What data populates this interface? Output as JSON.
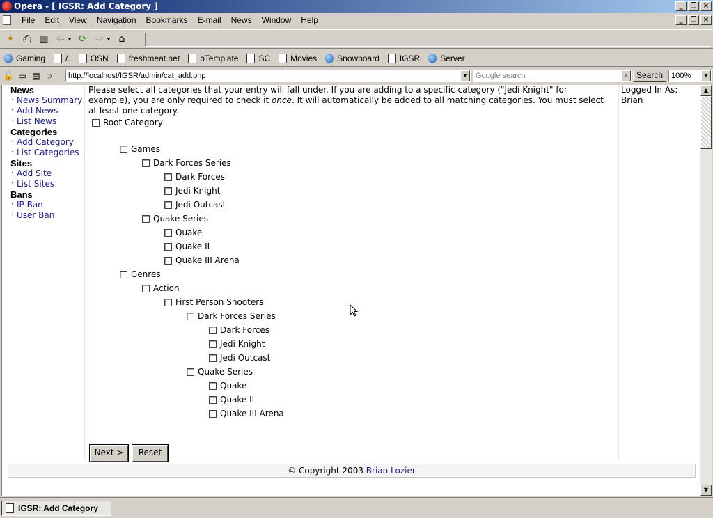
{
  "window": {
    "title": "Opera - [ IGSR: Add Category ]"
  },
  "menu": [
    "File",
    "Edit",
    "View",
    "Navigation",
    "Bookmarks",
    "E-mail",
    "News",
    "Window",
    "Help"
  ],
  "bookmarks": [
    {
      "label": "Gaming",
      "icon": "globe-icon"
    },
    {
      "label": "/.",
      "icon": "page-icon"
    },
    {
      "label": "OSN",
      "icon": "page-icon"
    },
    {
      "label": "freshmeat.net",
      "icon": "page-icon"
    },
    {
      "label": "bTemplate",
      "icon": "page-icon"
    },
    {
      "label": "SC",
      "icon": "page-icon"
    },
    {
      "label": "Movies",
      "icon": "page-icon"
    },
    {
      "label": "Snowboard",
      "icon": "globe-icon"
    },
    {
      "label": "IGSR",
      "icon": "page-icon"
    },
    {
      "label": "Server",
      "icon": "globe-icon"
    }
  ],
  "address": {
    "url": "http://localhost/IGSR/admin/cat_add.php",
    "search_placeholder": "Google search",
    "search_button": "Search",
    "zoom": "100%"
  },
  "nav": {
    "sections": [
      {
        "heading": "News",
        "links": [
          "News Summary",
          "Add News",
          "List News"
        ]
      },
      {
        "heading": "Categories",
        "links": [
          "Add Category",
          "List Categories"
        ]
      },
      {
        "heading": "Sites",
        "links": [
          "Add Site",
          "List Sites"
        ]
      },
      {
        "heading": "Bans",
        "links": [
          "IP Ban",
          "User Ban"
        ]
      }
    ]
  },
  "intro": {
    "part1": "Please select all categories that your entry will fall under. If you are adding to a specific category (\"Jedi Knight\" for example), you are only required to check it ",
    "emphasis": "once",
    "part2": ". It will automatically be added to all matching categories. You must select at least one category."
  },
  "categories": [
    {
      "label": "Root Category",
      "level": 0
    },
    {
      "label": "Games",
      "level": 1
    },
    {
      "label": "Dark Forces Series",
      "level": 2
    },
    {
      "label": "Dark Forces",
      "level": 3
    },
    {
      "label": "Jedi Knight",
      "level": 3
    },
    {
      "label": "Jedi Outcast",
      "level": 3
    },
    {
      "label": "Quake Series",
      "level": 2
    },
    {
      "label": "Quake",
      "level": 3
    },
    {
      "label": "Quake II",
      "level": 3
    },
    {
      "label": "Quake III Arena",
      "level": 3
    },
    {
      "label": "Genres",
      "level": 1
    },
    {
      "label": "Action",
      "level": 2
    },
    {
      "label": "First Person Shooters",
      "level": 3
    },
    {
      "label": "Dark Forces Series",
      "level": 4
    },
    {
      "label": "Dark Forces",
      "level": 5
    },
    {
      "label": "Jedi Knight",
      "level": 5
    },
    {
      "label": "Jedi Outcast",
      "level": 5
    },
    {
      "label": "Quake Series",
      "level": 4
    },
    {
      "label": "Quake",
      "level": 5
    },
    {
      "label": "Quake II",
      "level": 5
    },
    {
      "label": "Quake III Arena",
      "level": 5
    }
  ],
  "user": {
    "label": "Logged In As:",
    "name": "Brian"
  },
  "buttons": {
    "next": "Next >",
    "reset": "Reset"
  },
  "footer": {
    "text": "© Copyright 2003 ",
    "author": "Brian Lozier"
  },
  "tab": {
    "label": "IGSR: Add Category"
  }
}
